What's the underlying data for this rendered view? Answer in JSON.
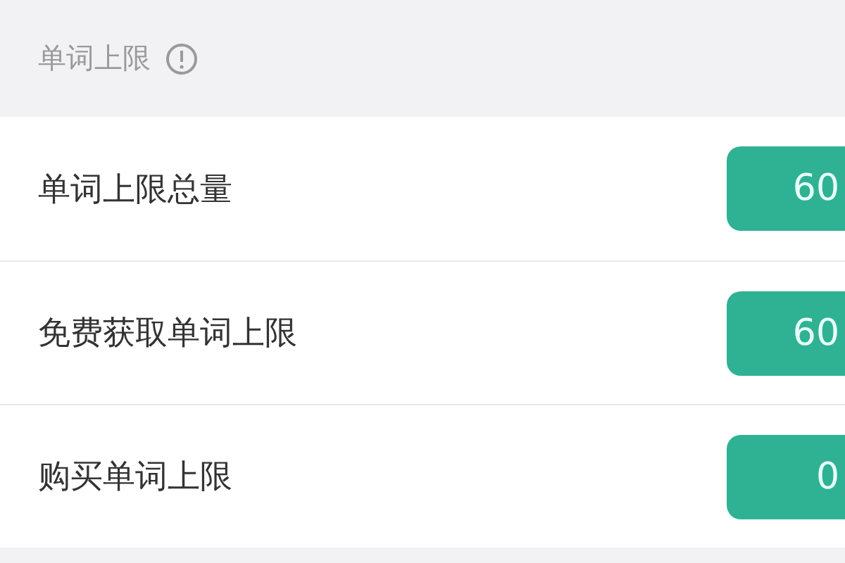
{
  "section": {
    "title": "单词上限"
  },
  "rows": [
    {
      "label": "单词上限总量",
      "value": "60"
    },
    {
      "label": "免费获取单词上限",
      "value": "60"
    },
    {
      "label": "购买单词上限",
      "value": "0"
    }
  ]
}
